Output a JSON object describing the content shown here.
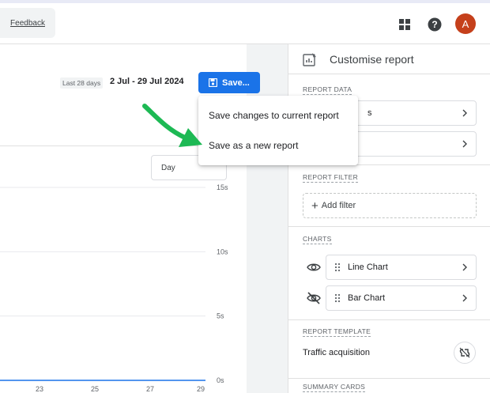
{
  "topbar": {
    "feedback_label": "Feedback",
    "avatar_letter": "A",
    "avatar_color": "#c5401b"
  },
  "toolbar": {
    "date_chip": "Last 28 days",
    "date_range": "2 Jul - 29 Jul 2024",
    "save_label": "Save...",
    "save_color": "#1a73e8"
  },
  "save_menu": {
    "items": [
      "Save changes to current report",
      "Save as a new report"
    ]
  },
  "granularity": {
    "selected": "Day"
  },
  "chart_data": {
    "type": "line",
    "x_tick_labels": [
      "23",
      "25",
      "27",
      "29"
    ],
    "y_tick_labels": [
      "15s",
      "10s",
      "5s",
      "0s"
    ],
    "ylim": [
      0,
      15
    ],
    "grid": true
  },
  "panel": {
    "title": "Customise report",
    "report_data_label": "REPORT DATA",
    "report_data_rows": [
      "s",
      ""
    ],
    "report_filter_label": "REPORT FILTER",
    "add_filter_label": "Add filter",
    "charts_label": "CHARTS",
    "charts": [
      {
        "name": "Line Chart",
        "visible": true
      },
      {
        "name": "Bar Chart",
        "visible": false
      }
    ],
    "template_label": "REPORT TEMPLATE",
    "template_name": "Traffic acquisition",
    "summary_label": "SUMMARY CARDS"
  },
  "icons": {
    "apps": "apps-grid-icon",
    "help": "help-icon",
    "customise": "customise-report-icon",
    "save": "save-icon",
    "chevron": "chevron-right-icon",
    "drag": "drag-handle-icon",
    "eye": "eye-icon",
    "eye_off": "eye-off-icon",
    "unlink": "link-off-icon",
    "arrow": "green-pointer-arrow"
  },
  "accent_colors": {
    "arrow": "#1db954",
    "axis_line": "#1a73e8"
  }
}
